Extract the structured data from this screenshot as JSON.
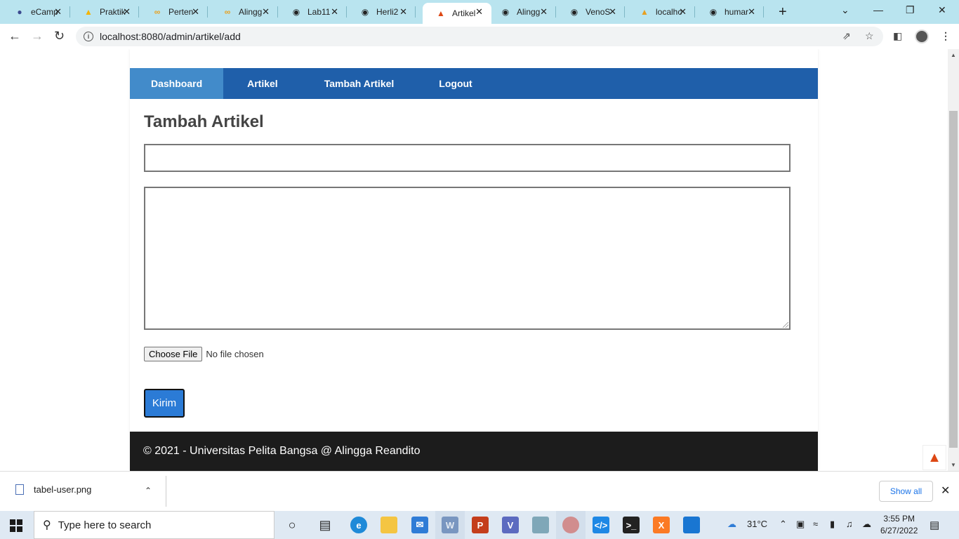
{
  "browser": {
    "tabs": [
      {
        "label": "eCamp",
        "icon": "owl-icon",
        "active": false
      },
      {
        "label": "Praktik",
        "icon": "google-drive-icon",
        "active": false
      },
      {
        "label": "Perten",
        "icon": "infinity-icon",
        "active": false
      },
      {
        "label": "Alingg",
        "icon": "infinity-icon",
        "active": false
      },
      {
        "label": "Lab11",
        "icon": "github-icon",
        "active": false
      },
      {
        "label": "Herli2",
        "icon": "github-icon",
        "active": false
      },
      {
        "label": "Artikel",
        "icon": "codeigniter-flame-icon",
        "active": true
      },
      {
        "label": "Alingg",
        "icon": "github-icon",
        "active": false
      },
      {
        "label": "VenoS",
        "icon": "github-icon",
        "active": false
      },
      {
        "label": "localhc",
        "icon": "phpmyadmin-icon",
        "active": false
      },
      {
        "label": "humar",
        "icon": "github-icon",
        "active": false
      }
    ],
    "url": "localhost:8080/admin/artikel/add"
  },
  "page": {
    "nav": [
      {
        "label": "Dashboard",
        "active": true
      },
      {
        "label": "Artikel",
        "active": false
      },
      {
        "label": "Tambah Artikel",
        "active": false
      },
      {
        "label": "Logout",
        "active": false
      }
    ],
    "heading": "Tambah Artikel",
    "form": {
      "title_value": "",
      "content_value": "",
      "file_button": "Choose File",
      "file_status": "No file chosen",
      "submit_label": "Kirim"
    },
    "footer": "© 2021 - Universitas Pelita Bangsa @ Alingga Reandito"
  },
  "downloads": {
    "file_name": "tabel-user.png",
    "show_all": "Show all"
  },
  "taskbar": {
    "search_placeholder": "Type here to search",
    "temperature": "31°C",
    "time": "3:55 PM",
    "date": "6/27/2022"
  },
  "colors": {
    "nav_bg": "#1f5faa",
    "nav_active": "#428bca",
    "submit_bg": "#2b7bd6",
    "footer_bg": "#1c1c1c",
    "tabstrip_bg": "#b9e4ef"
  }
}
